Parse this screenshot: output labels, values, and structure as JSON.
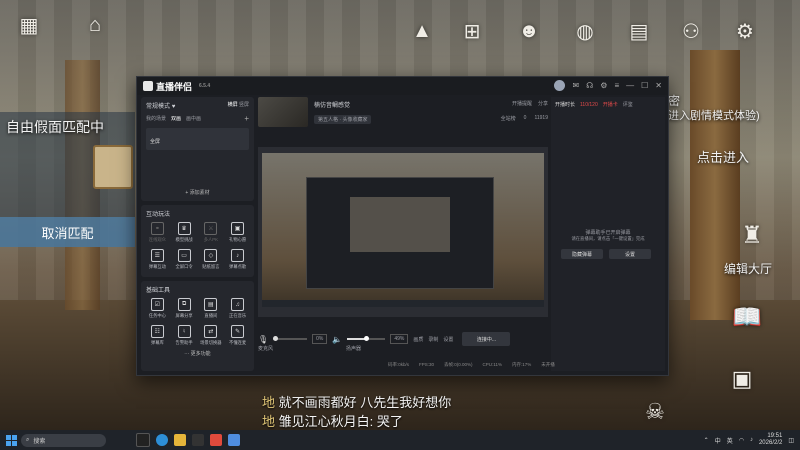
{
  "game": {
    "match_title": "自由假面匹配中",
    "cancel_label": "取消匹配",
    "click_enter": "点击进入",
    "right_top_1": "密",
    "right_top_2": "进入剧情模式体验)",
    "edit_lobby": "编辑大厅",
    "chat": [
      {
        "tag": "地",
        "text": "就不画雨都好 八先生我好想你"
      },
      {
        "tag": "地",
        "text": "雏见江心秋月白: 哭了"
      }
    ]
  },
  "app": {
    "name": "直播伴侣",
    "version": "6.5.4",
    "mode_label": "常规模式",
    "mode_right_1": "横屏",
    "mode_right_2": "竖屏",
    "scene_tabs": [
      "我的场景",
      "双画",
      "画中画"
    ],
    "source_item": "全屏",
    "add_source": "+ 添加素材",
    "interactive_title": "互动玩法",
    "interactive_tools": [
      "连线观众",
      "模型挑战",
      "多人PK",
      "礼物心愿",
      "弹幕互动",
      "全屏口令",
      "贴纸留言",
      "弹幕点歌"
    ],
    "basic_title": "基础工具",
    "basic_tools": [
      "任务中心",
      "屏幕分享",
      "直播间",
      "正在音乐",
      "弹幕库",
      "告警助手",
      "场景切换器",
      "不懂连麦"
    ],
    "more_features": "··· 更多功能",
    "room_title": "楠仿音鲷感觉",
    "room_tag": "第五人格 · 头像收藏家",
    "top_actions": [
      "开播提醒",
      "分享"
    ],
    "stats": [
      "全站榜",
      "0",
      "11919"
    ],
    "right_header": [
      "开播时长",
      "110/120",
      "开播卡",
      "评鉴"
    ],
    "assistant_hint_1": "弹幕助手已开启弹幕",
    "assistant_hint_2": "请在直播间，请点击「一键设置」完成",
    "assistant_btn_1": "隐藏弹幕",
    "assistant_btn_2": "设置",
    "mic_label": "麦克风",
    "speaker_label": "扬声器",
    "mic_value": "0%",
    "speaker_value": "49%",
    "controls": [
      "画质",
      "录制",
      "设置"
    ],
    "live_button": "连接中...",
    "status": [
      "码率:0kb/s",
      "FPS:30",
      "丢帧:0(0.00%)",
      "CPU:11%",
      "内存:17%",
      "未开播"
    ]
  },
  "taskbar": {
    "search_placeholder": "搜索",
    "time": "19:51",
    "date": "2026/2/2",
    "tray": [
      "中",
      "英"
    ]
  },
  "colors": {
    "accent": "#e0463b",
    "live_red": "#e34a4a"
  }
}
